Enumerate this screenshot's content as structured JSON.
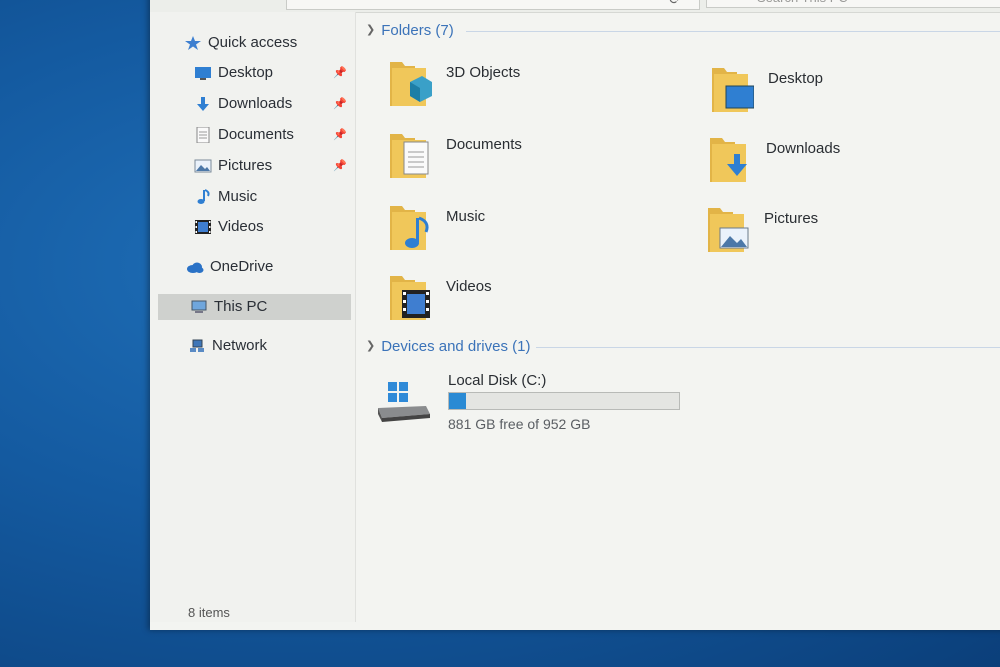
{
  "window": {
    "search_placeholder": "Search This PC"
  },
  "nav": {
    "quick_access": "Quick access",
    "items": [
      {
        "label": "Desktop",
        "pinned": true
      },
      {
        "label": "Downloads",
        "pinned": true
      },
      {
        "label": "Documents",
        "pinned": true
      },
      {
        "label": "Pictures",
        "pinned": true
      },
      {
        "label": "Music",
        "pinned": false
      },
      {
        "label": "Videos",
        "pinned": false
      }
    ],
    "onedrive": "OneDrive",
    "this_pc": "This PC",
    "network": "Network"
  },
  "folders": {
    "header": "Folders (7)",
    "items": [
      {
        "label": "3D Objects",
        "icon": "3d-objects-folder-icon"
      },
      {
        "label": "Desktop",
        "icon": "desktop-folder-icon"
      },
      {
        "label": "Documents",
        "icon": "documents-folder-icon"
      },
      {
        "label": "Downloads",
        "icon": "downloads-folder-icon"
      },
      {
        "label": "Music",
        "icon": "music-folder-icon"
      },
      {
        "label": "Pictures",
        "icon": "pictures-folder-icon"
      },
      {
        "label": "Videos",
        "icon": "videos-folder-icon"
      }
    ]
  },
  "devices": {
    "header": "Devices and drives (1)",
    "drive": {
      "name": "Local Disk (C:)",
      "free_text": "881 GB free of 952 GB",
      "used_fraction": 0.075,
      "fill_color": "#2a8ad4"
    }
  },
  "status": {
    "item_count": "8 items"
  },
  "colors": {
    "accent": "#3b73b9",
    "folder_yellow": "#f0c75a",
    "selection": "#cfd1ce"
  }
}
